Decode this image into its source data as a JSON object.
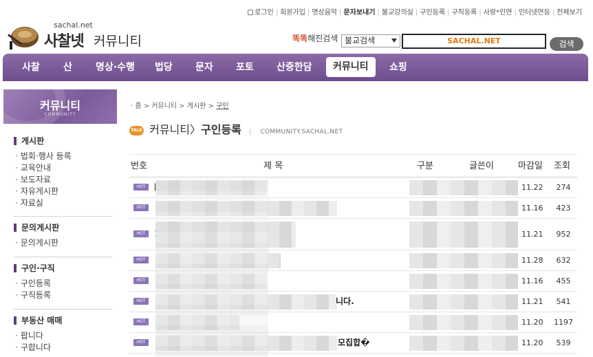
{
  "toplinks": [
    {
      "label": "로그인",
      "bold": false,
      "icon": true
    },
    {
      "label": "회원가입",
      "bold": false
    },
    {
      "label": "명상음악",
      "bold": false
    },
    {
      "label": "문자보내기",
      "bold": true
    },
    {
      "label": "불교강의실",
      "bold": false
    },
    {
      "label": "구인등록",
      "bold": false
    },
    {
      "label": "구직등록",
      "bold": false
    },
    {
      "label": "사랑*인연",
      "bold": false
    },
    {
      "label": "인터넷연등",
      "bold": false
    },
    {
      "label": "전체보기",
      "bold": false
    }
  ],
  "logo": {
    "domain": "sachal.net",
    "brand": "사찰넷",
    "section": "커뮤니티"
  },
  "search": {
    "label_prefix": "똑똑",
    "label": "해진검색",
    "select_value": "불교검색",
    "input_value": "SACHAL.NET",
    "button": "검색"
  },
  "nav": [
    {
      "label": "사찰",
      "active": false
    },
    {
      "label": "산",
      "active": false
    },
    {
      "label": "명상·수행",
      "active": false
    },
    {
      "label": "법당",
      "active": false
    },
    {
      "label": "문자",
      "active": false
    },
    {
      "label": "포토",
      "active": false
    },
    {
      "label": "산중한담",
      "active": false
    },
    {
      "label": "커뮤니티",
      "active": true
    },
    {
      "label": "쇼핑",
      "active": false
    }
  ],
  "sidebar": {
    "title": "커뮤니티",
    "subtitle": "COMMUNITY",
    "groups": [
      {
        "heading": "게시판",
        "items": [
          "법회·행사 등록",
          "교육안내",
          "보도자료",
          "자유게시판",
          "자료실"
        ]
      },
      {
        "heading": "문의게시판",
        "items": [
          "문의게시판"
        ]
      },
      {
        "heading": "구인·구직",
        "items": [
          "구인등록",
          "구직등록"
        ]
      },
      {
        "heading": "부동산 매매",
        "items": [
          "팝니다",
          "구합니다"
        ]
      }
    ]
  },
  "breadcrumb": {
    "home": "홈",
    "sep": " > ",
    "items": [
      "커뮤니티",
      "게시판"
    ],
    "current": "구인"
  },
  "page": {
    "talk": "TALK",
    "section": "커뮤니티",
    "arrow": "〉",
    "title": "구인등록",
    "sub": "COMMUNITY.SACHAL.NET"
  },
  "table": {
    "headers": {
      "no": "번호",
      "title": "제 목",
      "category": "구분",
      "author": "글쓴이",
      "due": "마감일",
      "views": "조회"
    },
    "rows": [
      {
        "hot": "HOT",
        "prefix": "[",
        "tail": "",
        "due": "11.22",
        "views": "274"
      },
      {
        "hot": "HOT",
        "prefix": "",
        "tail": "",
        "due": "11.16",
        "views": "423"
      },
      {
        "hot": "HOT",
        "prefix": "1",
        "tail": "",
        "due": "11.21",
        "views": "952"
      },
      {
        "hot": "HOT",
        "prefix": "",
        "tail": "",
        "due": "11.28",
        "views": "632"
      },
      {
        "hot": "HOT",
        "prefix": "",
        "tail": "",
        "due": "11.16",
        "views": "455"
      },
      {
        "hot": "HOT",
        "prefix": "",
        "tail": "니다.",
        "due": "11.21",
        "views": "541"
      },
      {
        "hot": "HOT",
        "prefix": "",
        "tail": "",
        "due": "11.20",
        "views": "1197"
      },
      {
        "hot": "HOT",
        "prefix": "",
        "tail": "모집합�",
        "due": "11.20",
        "views": "539"
      }
    ]
  },
  "icons": {
    "lock": "lock-icon",
    "select": "chevron-down-icon",
    "hot": "hot-badge-icon",
    "talk": "talk-bubble-icon",
    "logo": "drum-logo-icon"
  },
  "colors": {
    "nav": "#7b5b99",
    "hot": "#8a74b6",
    "search_text": "#e07a10",
    "accent": "#d4522c"
  }
}
